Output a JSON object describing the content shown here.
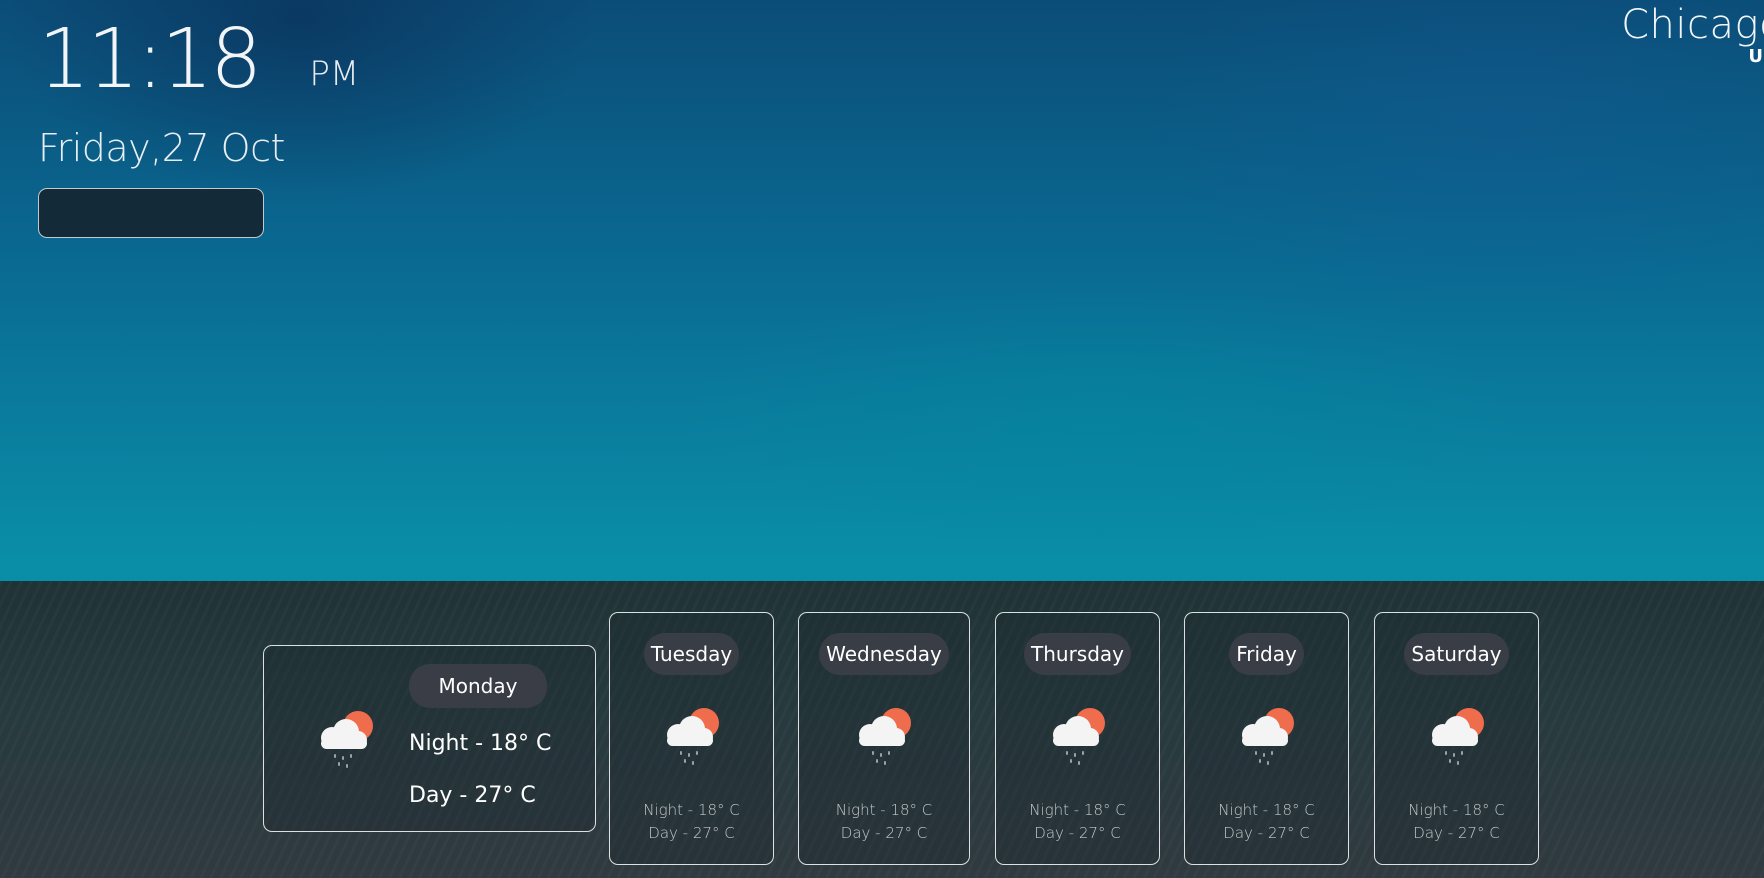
{
  "clock": {
    "time": "11:18",
    "ampm": "PM",
    "date": "Friday,27 Oct"
  },
  "location": {
    "city": "Chicago",
    "country": "US"
  },
  "forecast": {
    "today": {
      "day": "Monday",
      "night": "Night - 18° C",
      "daytime": "Day - 27° C",
      "icon": "cloud-sun-rain-icon"
    },
    "days": [
      {
        "day": "Tuesday",
        "night": "Night - 18° C",
        "daytime": "Day - 27° C",
        "icon": "cloud-sun-rain-icon"
      },
      {
        "day": "Wednesday",
        "night": "Night - 18° C",
        "daytime": "Day - 27° C",
        "icon": "cloud-sun-rain-icon"
      },
      {
        "day": "Thursday",
        "night": "Night - 18° C",
        "daytime": "Day - 27° C",
        "icon": "cloud-sun-rain-icon"
      },
      {
        "day": "Friday",
        "night": "Night - 18° C",
        "daytime": "Day - 27° C",
        "icon": "cloud-sun-rain-icon"
      },
      {
        "day": "Saturday",
        "night": "Night - 18° C",
        "daytime": "Day - 27° C",
        "icon": "cloud-sun-rain-icon"
      }
    ]
  },
  "colors": {
    "sun": "#ef6c4c",
    "cloud": "#f4f4f4",
    "panel": "#263a3e",
    "sky_top": "#0b4d78",
    "sky_bottom": "#0aa2b4"
  }
}
